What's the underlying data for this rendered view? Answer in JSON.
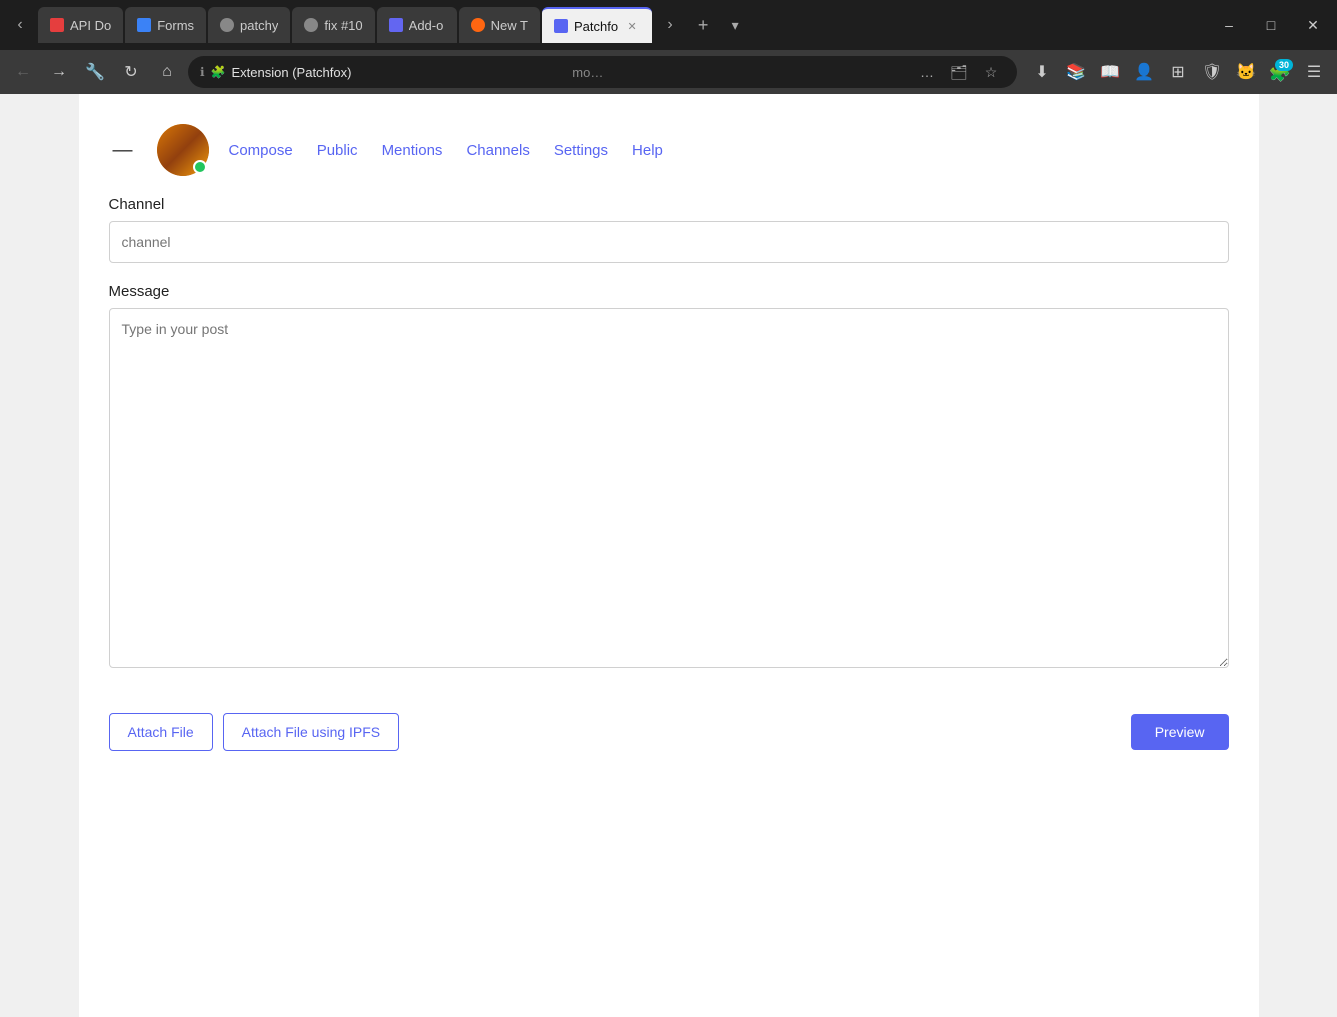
{
  "browser": {
    "tabs": [
      {
        "id": "api-doc",
        "favicon_type": "fav-red",
        "title": "API Do",
        "closable": false,
        "active": false
      },
      {
        "id": "forms",
        "favicon_type": "fav-blue",
        "title": "Forms",
        "closable": false,
        "active": false
      },
      {
        "id": "patchy",
        "favicon_type": "fav-gray",
        "title": "patchy",
        "closable": false,
        "active": false
      },
      {
        "id": "fix10",
        "favicon_type": "fav-gray",
        "title": "fix #10",
        "closable": false,
        "active": false
      },
      {
        "id": "addon",
        "favicon_type": "fav-puzzle",
        "title": "Add-o",
        "closable": false,
        "active": false
      },
      {
        "id": "new-tab",
        "favicon_type": "fav-firefox",
        "title": "New T",
        "closable": false,
        "active": false
      },
      {
        "id": "patchfox",
        "favicon_type": "fav-patchfox",
        "title": "Patchfo",
        "closable": true,
        "active": true
      }
    ],
    "address_bar": {
      "security_icon": "ℹ",
      "extension_icon": "🧩",
      "url": "Extension (Patchfox)",
      "url_extra": "mo…",
      "more_btn": "…"
    },
    "toolbar": {
      "download_icon": "⬇",
      "bookmarks_icon": "📚",
      "reader_icon": "📖",
      "profile_icon": "👤",
      "grid_icon": "⊞",
      "shield_icon": "🛡",
      "cat_icon": "🐱",
      "extensions_icon": "🧩",
      "badge_count": "30",
      "menu_icon": "☰"
    }
  },
  "nav": {
    "collapse_icon": "—",
    "links": [
      {
        "id": "compose",
        "label": "Compose"
      },
      {
        "id": "public",
        "label": "Public"
      },
      {
        "id": "mentions",
        "label": "Mentions"
      },
      {
        "id": "channels",
        "label": "Channels"
      },
      {
        "id": "settings",
        "label": "Settings"
      },
      {
        "id": "help",
        "label": "Help"
      }
    ]
  },
  "form": {
    "channel_label": "Channel",
    "channel_placeholder": "channel",
    "message_label": "Message",
    "message_placeholder": "Type in your post",
    "attach_file_label": "Attach File",
    "attach_ipfs_label": "Attach File using IPFS",
    "preview_label": "Preview"
  }
}
